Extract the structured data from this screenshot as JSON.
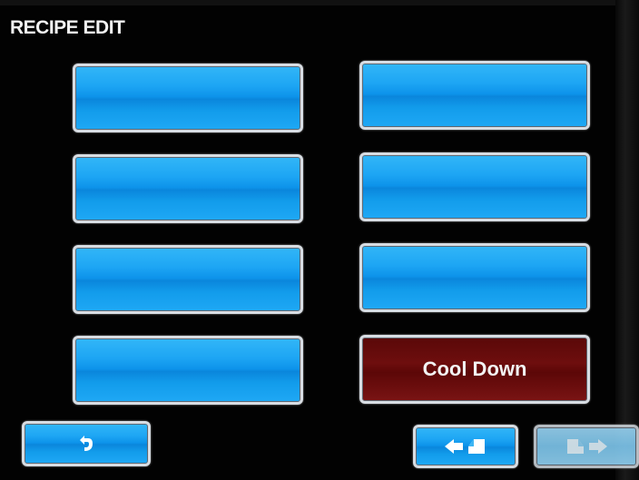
{
  "header": {
    "title": "RECIPE EDIT"
  },
  "recipe_buttons": [
    {
      "label": ""
    },
    {
      "label": ""
    },
    {
      "label": ""
    },
    {
      "label": ""
    },
    {
      "label": ""
    },
    {
      "label": ""
    },
    {
      "label": ""
    },
    {
      "label": "Cool Down"
    }
  ],
  "nav": {
    "back_icon": "back-arrow-icon",
    "prev_page_icon": "page-previous-icon",
    "next_page_icon": "page-next-icon",
    "next_page_enabled": false
  },
  "colors": {
    "button_blue": "#1ea6f4",
    "button_red": "#6e0e0e",
    "background": "#000000",
    "border": "#d8dde3"
  }
}
